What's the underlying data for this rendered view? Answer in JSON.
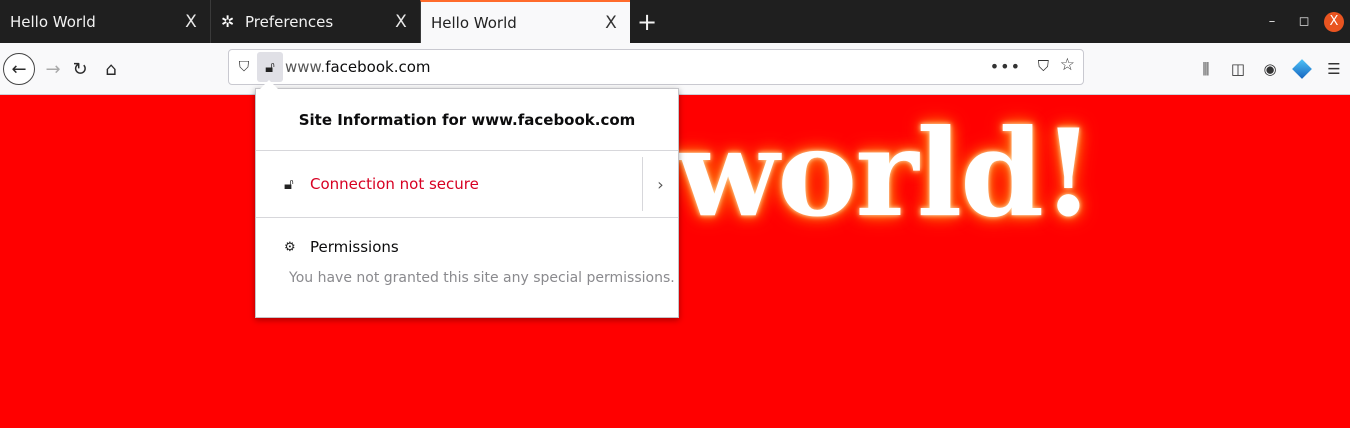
{
  "tabs": [
    {
      "title": "Hello World",
      "close": "X",
      "icon": ""
    },
    {
      "title": "Preferences",
      "close": "X",
      "icon": "gear-icon"
    },
    {
      "title": "Hello World",
      "close": "X",
      "icon": "",
      "active": true
    }
  ],
  "new_tab_label": "+",
  "window_controls": {
    "minimize": "–",
    "maximize": "◻",
    "close": "X"
  },
  "navbar": {
    "url_prefix": "www.",
    "url_host": "facebook.com",
    "more_label": "•••"
  },
  "page": {
    "headline": "world!",
    "background_color": "#ff0000"
  },
  "site_info": {
    "title": "Site Information for www.facebook.com",
    "connection_label": "Connection not secure",
    "connection_color": "#d70022",
    "more_arrow": "›",
    "permissions_title": "Permissions",
    "permissions_desc": "You have not granted this site any special permissions."
  },
  "colors": {
    "accent": "#ff6b2b",
    "tabstrip": "#1f1f1f",
    "toolbar": "#f9f9fa"
  }
}
